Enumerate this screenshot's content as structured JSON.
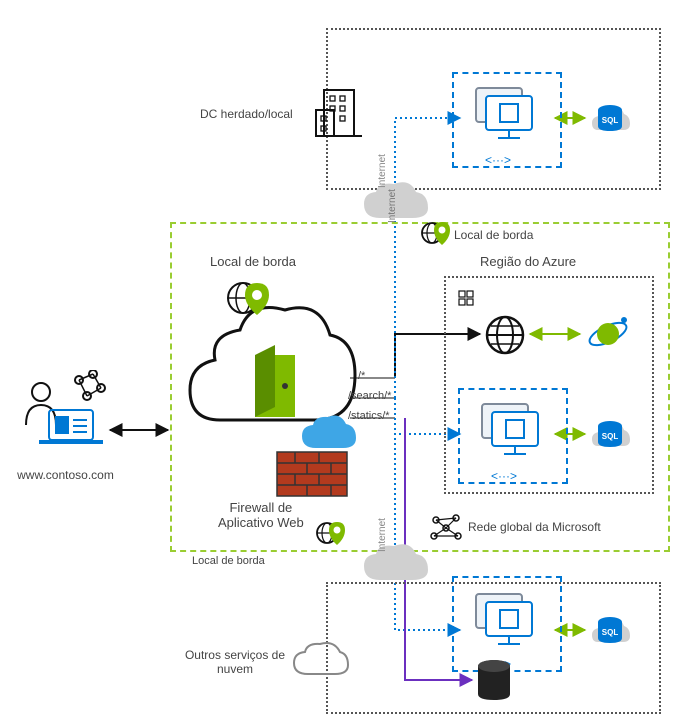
{
  "users": {
    "url": "www.contoso.com"
  },
  "waf": {
    "edge_top": "Local de borda",
    "title": "Firewall de\nAplicativo Web",
    "edge_bottom": "Local de borda",
    "edge_pill": "Local de borda"
  },
  "legacy": {
    "title": "DC herdado/local"
  },
  "azure_region": {
    "title": "Região do Azure"
  },
  "ms_network": {
    "title": "Rede global da Microsoft"
  },
  "other_cloud": {
    "title": "Outros serviços de\nnuvem"
  },
  "routes": {
    "root": "/*",
    "search": "/search/*",
    "statics": "/statics/*"
  },
  "internet": "Internet"
}
